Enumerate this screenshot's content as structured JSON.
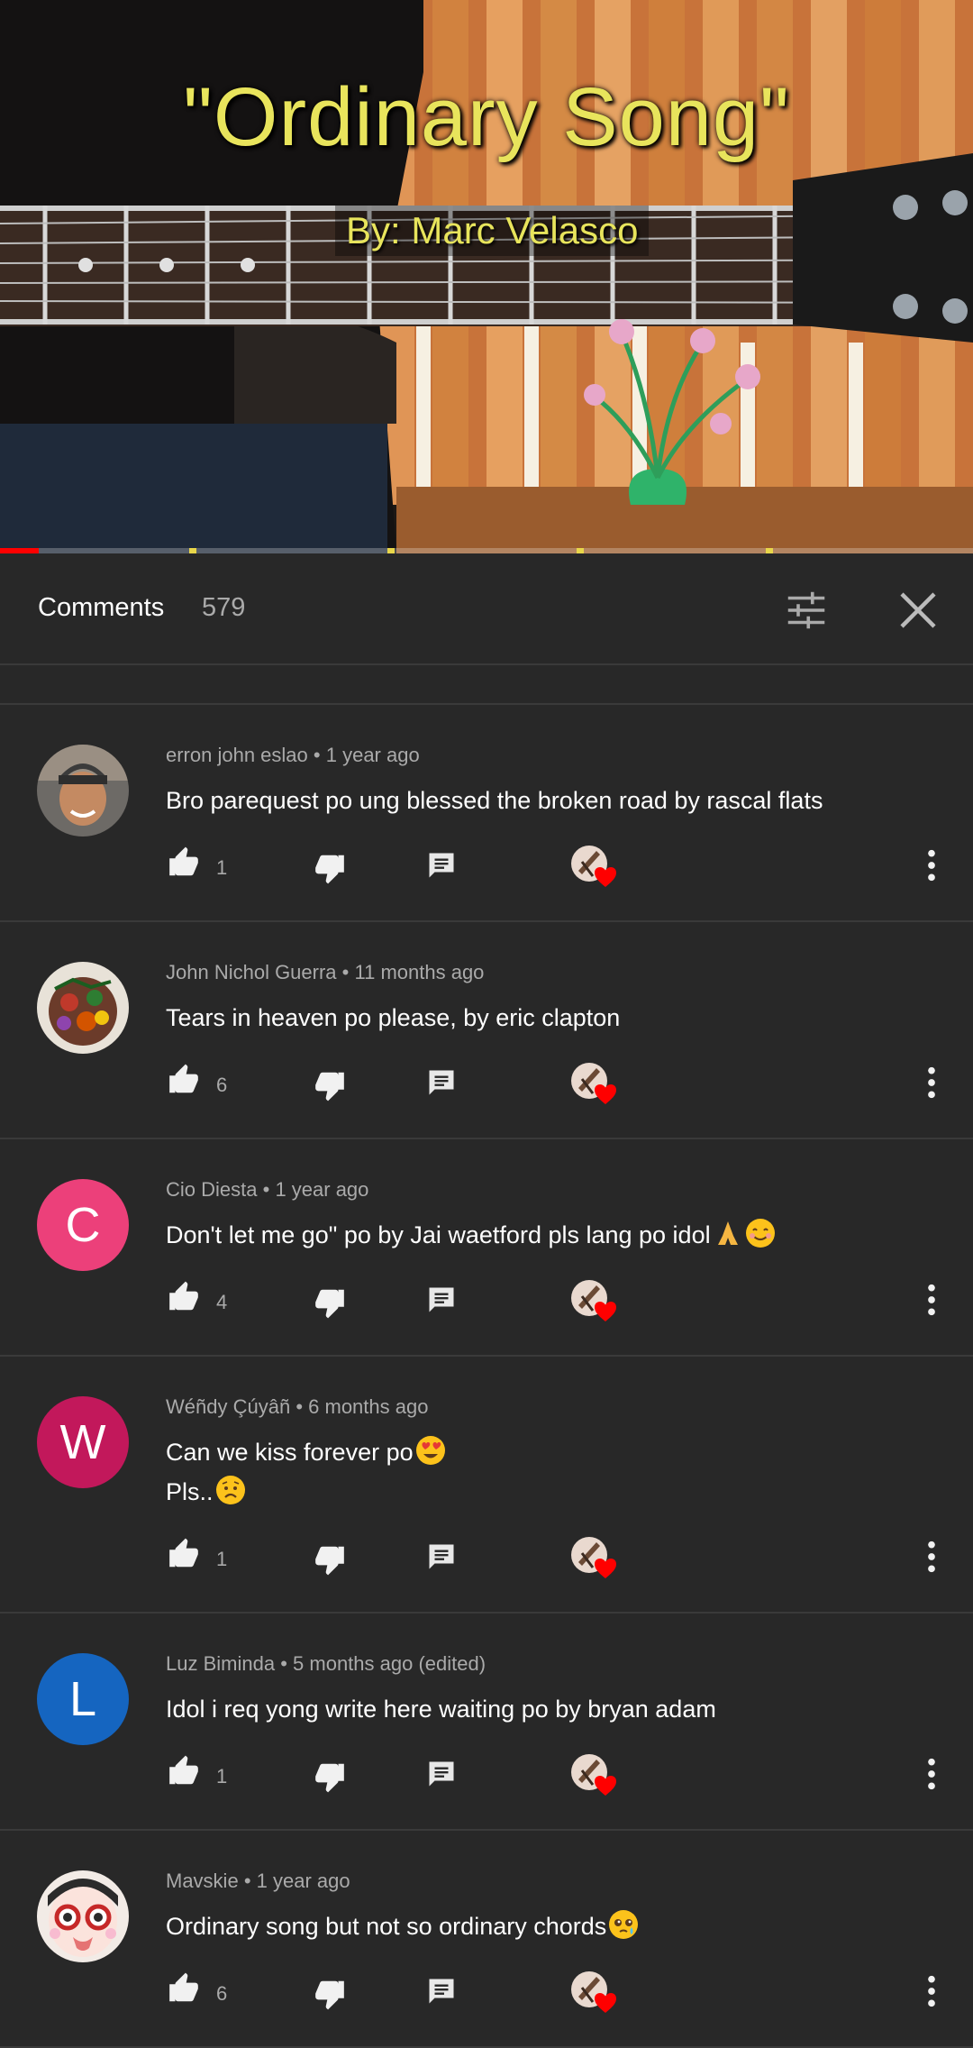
{
  "video": {
    "title": "\"Ordinary Song\"",
    "subtitle": "By: Marc Velasco",
    "progress_fraction": 0.04
  },
  "comments_panel": {
    "title": "Comments",
    "count": "579",
    "filter_icon": "sort-filter-icon",
    "close_icon": "close-icon"
  },
  "colors": {
    "background": "#282828",
    "divider": "#3a3a3a",
    "progress_played": "#ff0000",
    "title_yellow": "#e8e45c",
    "heart_red": "#ff0000"
  },
  "comments": [
    {
      "author": "erron john eslao",
      "time": "1 year ago",
      "lines": [
        "Bro parequest po ung blessed the broken road by rascal flats"
      ],
      "likes": "1",
      "avatar": {
        "type": "photo"
      }
    },
    {
      "author": "John Nichol Guerra",
      "time": "11 months ago",
      "lines": [
        "Tears in heaven po please, by eric clapton"
      ],
      "likes": "6",
      "avatar": {
        "type": "photo"
      }
    },
    {
      "author": "Cio Diesta",
      "time": "1 year ago",
      "lines": [
        "Don't let me go\" po by Jai waetford pls lang po idol"
      ],
      "emoji": [
        "pray",
        "smile"
      ],
      "likes": "4",
      "avatar": {
        "type": "letter",
        "letter": "C",
        "color": "#ec407a"
      }
    },
    {
      "author": "Wéñdy Çúyâñ",
      "time": "6 months ago",
      "lines": [
        "Can we kiss forever po",
        "Pls.."
      ],
      "emoji": [
        "heart-eyes",
        "sad"
      ],
      "likes": "1",
      "avatar": {
        "type": "letter",
        "letter": "W",
        "color": "#c2185b"
      }
    },
    {
      "author": "Luz Biminda",
      "time": "5 months ago (edited)",
      "lines": [
        "Idol i req yong write here waiting po by bryan adam"
      ],
      "likes": "1",
      "avatar": {
        "type": "letter",
        "letter": "L",
        "color": "#1565c0"
      }
    },
    {
      "author": "Mavskie",
      "time": "1 year ago",
      "lines": [
        "Ordinary song but not so ordinary chords"
      ],
      "emoji": [
        "pleading"
      ],
      "likes": "6",
      "avatar": {
        "type": "photo"
      }
    }
  ]
}
